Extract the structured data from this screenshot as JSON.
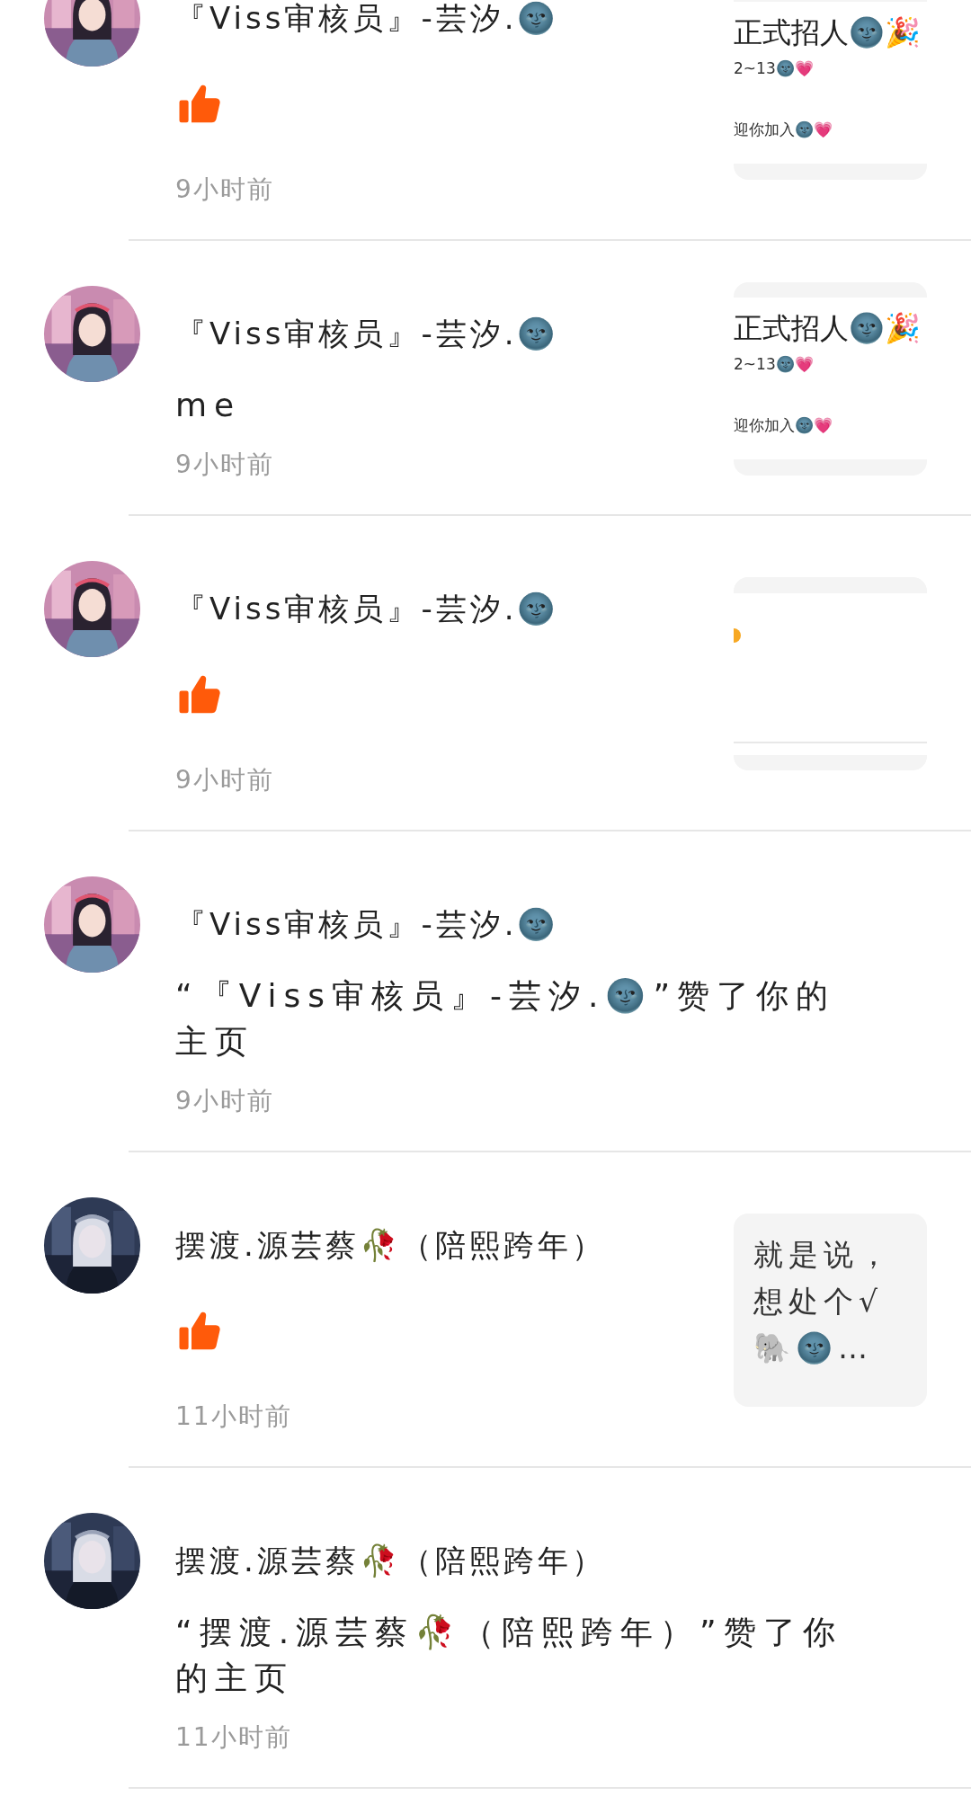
{
  "notifications": [
    {
      "name": "『Viss审核员』-芸汐.🌚",
      "content": {
        "kind": "like"
      },
      "time": "9小时前",
      "preview": {
        "kind": "post",
        "lines": [
          "正式招人🌚🎉",
          "2~13🌚💗",
          "迎你加入🌚💗"
        ]
      }
    },
    {
      "name": "『Viss审核员』-芸汐.🌚",
      "content": {
        "kind": "text",
        "text": "me"
      },
      "time": "9小时前",
      "preview": {
        "kind": "post",
        "lines": [
          "正式招人🌚🎉",
          "2~13🌚💗",
          "迎你加入🌚💗"
        ]
      }
    },
    {
      "name": "『Viss审核员』-芸汐.🌚",
      "content": {
        "kind": "like"
      },
      "time": "9小时前"
    },
    {
      "name": "『Viss审核员』-芸汐.🌚",
      "content": {
        "kind": "text",
        "text": "“『Viss审核员』-芸汐.🌚”赞了你的主页"
      },
      "time": "9小时前"
    },
    {
      "name": "摆渡.源芸蔡🥀（陪熙跨年）",
      "content": {
        "kind": "like"
      },
      "time": "11小时前",
      "preview": {
        "kind": "text",
        "text": "就是说，想处个√🐘🌚…"
      }
    },
    {
      "name": "摆渡.源芸蔡🥀（陪熙跨年）",
      "content": {
        "kind": "text",
        "text": "“摆渡.源芸蔡🥀（陪熙跨年）”赞了你的主页"
      },
      "time": "11小时前"
    }
  ]
}
